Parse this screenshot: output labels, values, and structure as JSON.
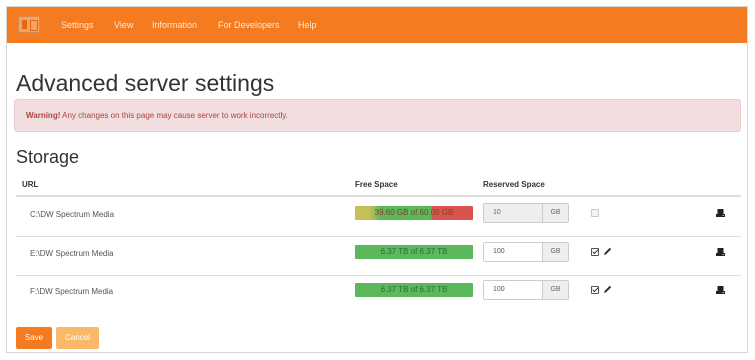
{
  "navbar": {
    "items": [
      {
        "label": "Settings"
      },
      {
        "label": "View"
      },
      {
        "label": "Information"
      },
      {
        "label": "For Developers"
      },
      {
        "label": "Help"
      }
    ]
  },
  "page": {
    "title": "Advanced server settings"
  },
  "alert": {
    "strong": "Warning!",
    "text": " Any changes on this page may cause server to work incorrectly."
  },
  "storage": {
    "section_title": "Storage",
    "columns": {
      "url": "URL",
      "free_space": "Free Space",
      "reserved_space": "Reserved Space"
    },
    "rows": [
      {
        "url": "C:\\DW Spectrum Media",
        "free_space": "39.60 GB of 60.00 GB",
        "free_fraction": 0.66,
        "reserved": "10",
        "unit": "GB",
        "enabled": false,
        "editable": false
      },
      {
        "url": "E:\\DW Spectrum Media",
        "free_space": "6.37 TB of 6.37 TB",
        "free_fraction": 1.0,
        "reserved": "100",
        "unit": "GB",
        "enabled": true,
        "editable": true
      },
      {
        "url": "F:\\DW Spectrum Media",
        "free_space": "6.37 TB of 6.37 TB",
        "free_fraction": 1.0,
        "reserved": "100",
        "unit": "GB",
        "enabled": true,
        "editable": true
      }
    ]
  },
  "actions": {
    "save_label": "Save",
    "cancel_label": "Cancel"
  },
  "colors": {
    "brand": "#f47b20",
    "alert_bg": "#f2dede",
    "alert_text": "#a94442",
    "bar_green": "#5cb85c",
    "bar_red": "#d9534f"
  },
  "icons": [
    "logo-icon",
    "checkbox-icon",
    "pencil-icon",
    "hard-drive-icon"
  ]
}
